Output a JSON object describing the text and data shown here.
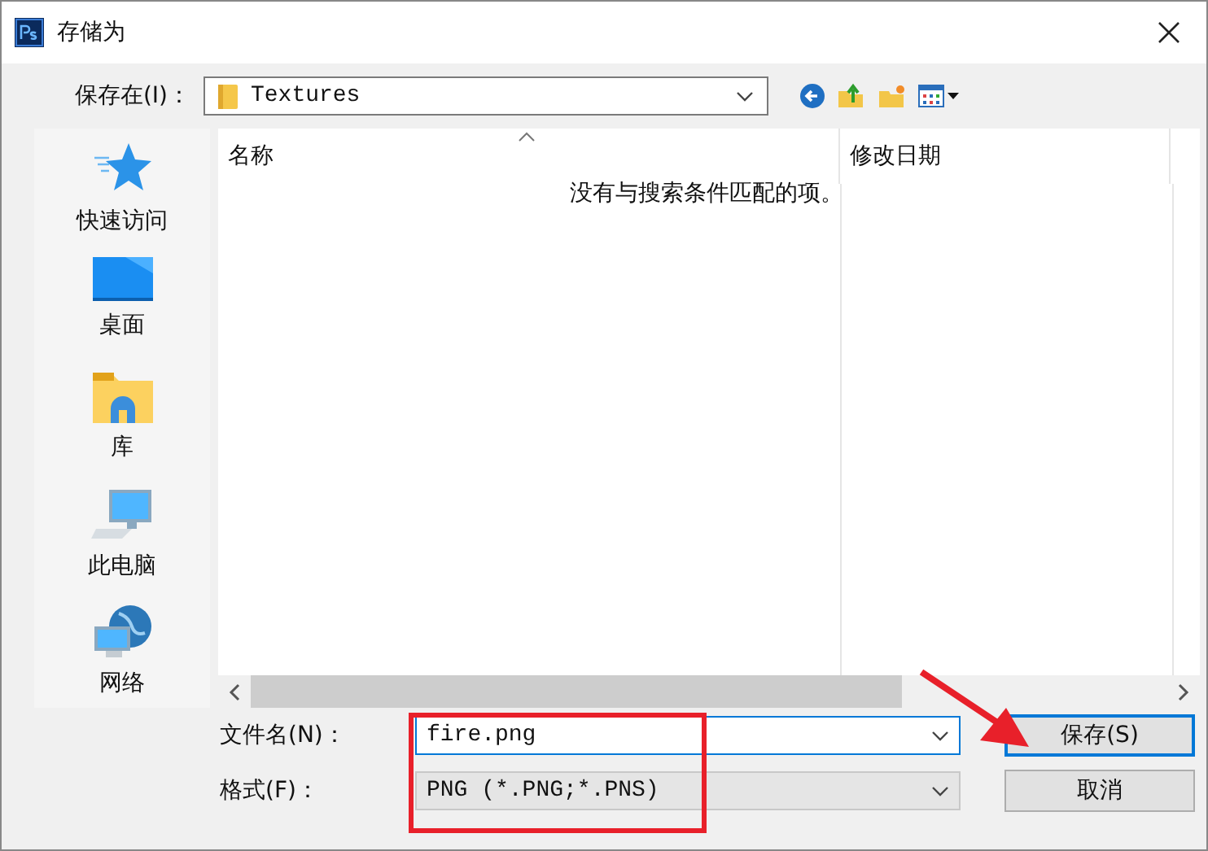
{
  "window": {
    "title": "存储为"
  },
  "location": {
    "label": "保存在(I)：",
    "value": "Textures"
  },
  "sidebar": {
    "items": [
      {
        "label": "快速访问",
        "kind": "star"
      },
      {
        "label": "桌面",
        "kind": "desktop"
      },
      {
        "label": "库",
        "kind": "library"
      },
      {
        "label": "此电脑",
        "kind": "computer"
      },
      {
        "label": "网络",
        "kind": "network"
      }
    ]
  },
  "file_list": {
    "columns": [
      "名称",
      "修改日期"
    ],
    "empty_message": "没有与搜索条件匹配的项。"
  },
  "file_name": {
    "label": "文件名(N)：",
    "value": "fire.png"
  },
  "format": {
    "label": "格式(F)：",
    "value": "PNG (*.PNG;*.PNS)"
  },
  "buttons": [
    {
      "label": "保存(S)",
      "kind": "primary"
    },
    {
      "label": "取消",
      "kind": "normal"
    }
  ]
}
